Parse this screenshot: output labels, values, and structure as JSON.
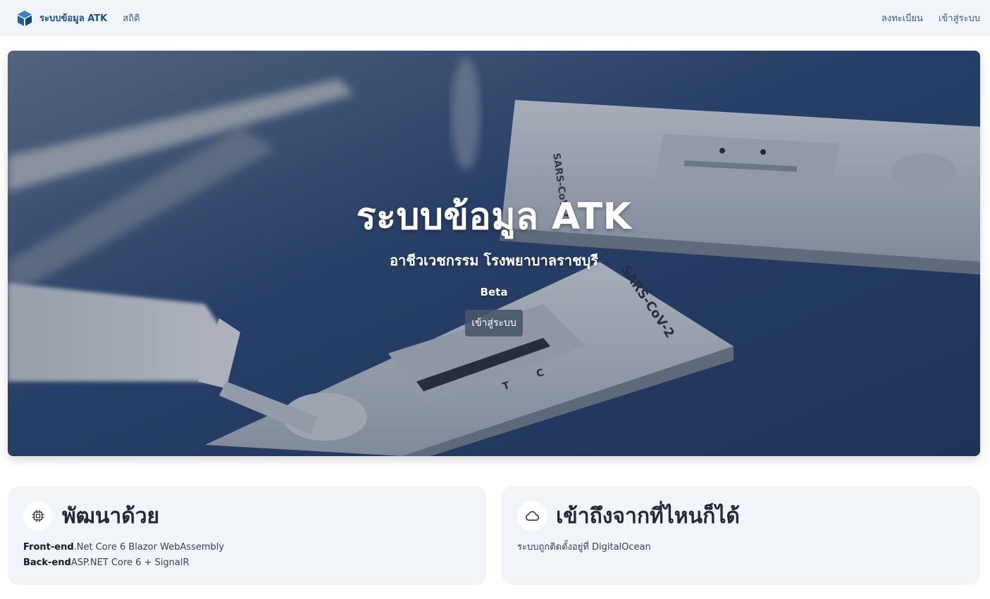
{
  "navbar": {
    "brand": "ระบบข้อมูล ATK",
    "links_left": [
      "สถิติ"
    ],
    "links_right": [
      "ลงทะเบียน",
      "เข้าสู่ระบบ"
    ]
  },
  "hero": {
    "title": "ระบบข้อมูล ATK",
    "subtitle": "อาชีวเวชกรรม โรงพยาบาลราชบุรี",
    "badge": "Beta",
    "button_label": "เข้าสู่ระบบ",
    "image_labels": [
      "SARS-CoV-2",
      "SARS-CoV-2",
      "C",
      "T"
    ]
  },
  "cards": [
    {
      "icon": "cpu-chip-icon",
      "title": "พัฒนาด้วย",
      "lines": [
        {
          "label": "Front-end",
          "text": ".Net Core 6 Blazor WebAssembly"
        },
        {
          "label": "Back-end",
          "text": "ASP.NET Core 6 + SignalR"
        }
      ]
    },
    {
      "icon": "cloud-icon",
      "title": "เข้าถึงจากที่ไหนก็ได้",
      "lines": [
        {
          "label": "",
          "text": "ระบบถูกติดตั้งอยู่ที่ DigitalOcean"
        }
      ]
    }
  ],
  "colors": {
    "navbar_bg": "#f1f5f9",
    "brand": "#1e4f8f",
    "hero_bg": "#2c4670",
    "card_bg": "#f1f5f9",
    "button_bg": "#475569"
  }
}
